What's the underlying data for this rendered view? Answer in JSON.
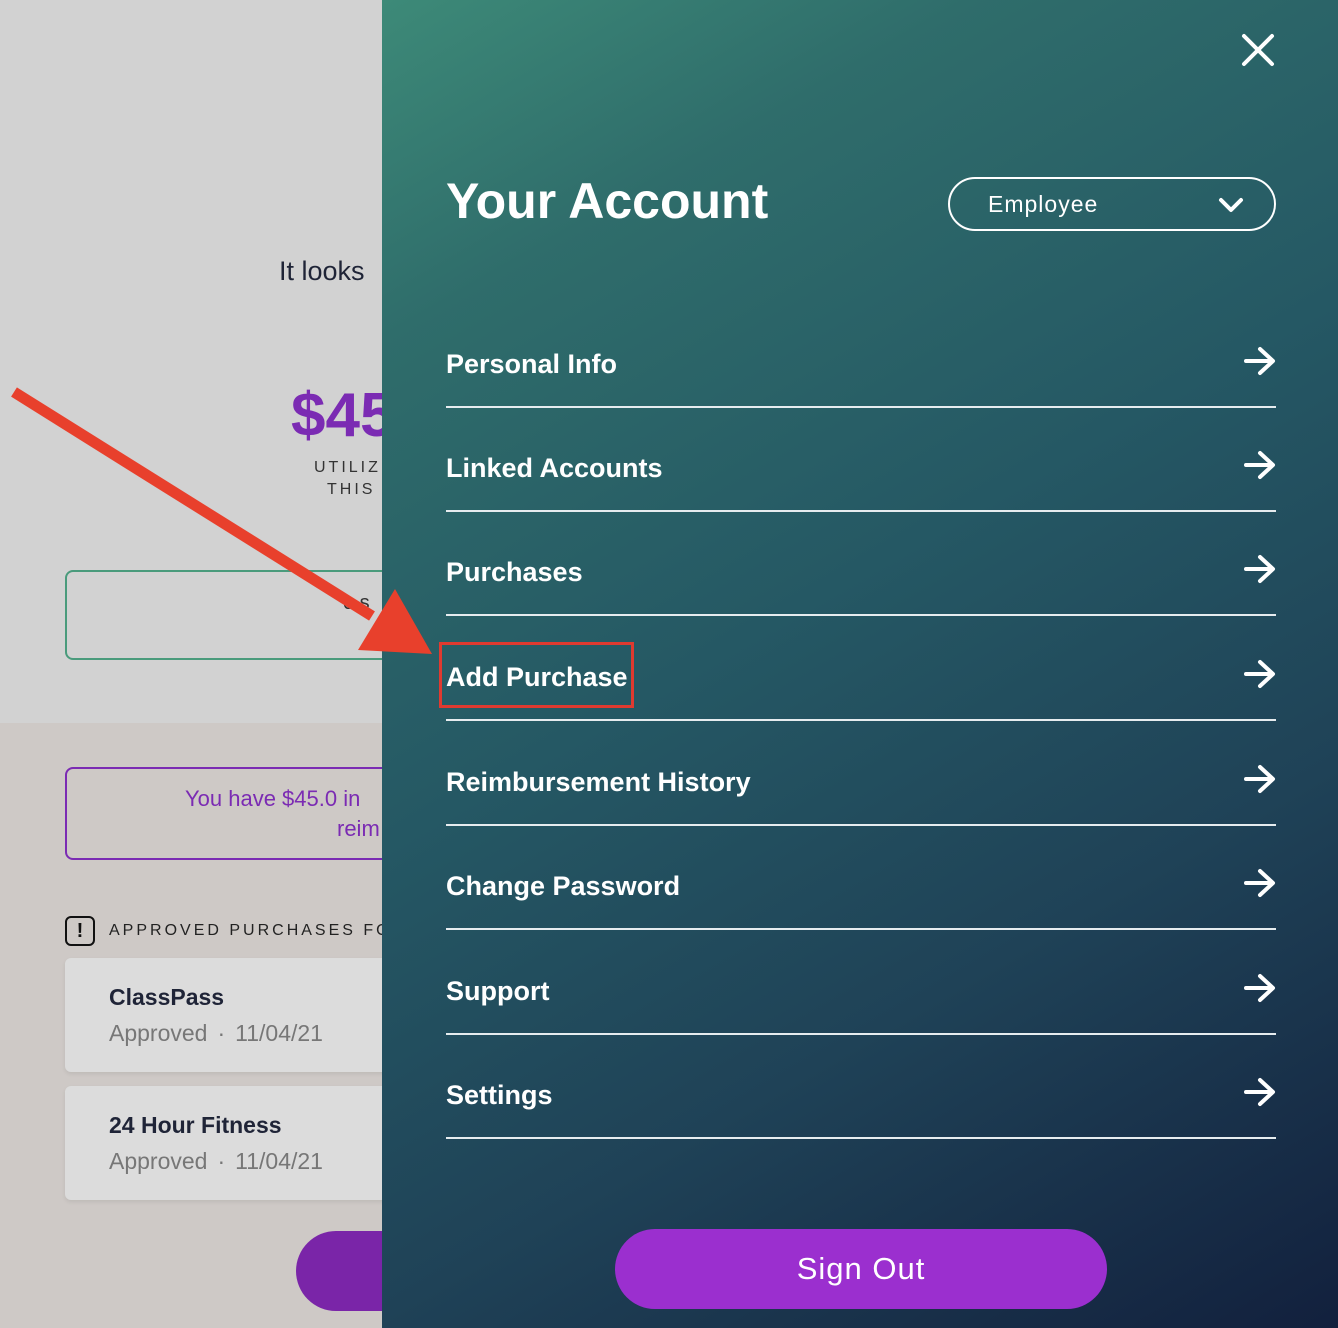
{
  "background": {
    "empty_message": "It looks",
    "amount": "$45",
    "utilized_label": "UTILIZ",
    "this_label": "THIS",
    "outline_button_label": "o s",
    "notice_line1": "You have $45.0 in",
    "notice_line2": "reim",
    "approved_header": "APPROVED PURCHASES FOI",
    "purchases": [
      {
        "name": "ClassPass",
        "status": "Approved",
        "date": "11/04/21"
      },
      {
        "name": "24 Hour Fitness",
        "status": "Approved",
        "date": "11/04/21"
      }
    ]
  },
  "drawer": {
    "title": "Your Account",
    "role_select": {
      "value": "Employee"
    },
    "menu_items": [
      {
        "label": "Personal Info"
      },
      {
        "label": "Linked Accounts"
      },
      {
        "label": "Purchases"
      },
      {
        "label": "Add Purchase",
        "highlighted": true
      },
      {
        "label": "Reimbursement History"
      },
      {
        "label": "Change Password"
      },
      {
        "label": "Support"
      },
      {
        "label": "Settings"
      }
    ],
    "sign_out_label": "Sign Out"
  },
  "colors": {
    "accent_purple": "#9b2fcf",
    "annotation_red": "#e03a30",
    "drawer_teal": "#2f6d6b"
  },
  "icons": {
    "close": "close-icon",
    "dropdown": "chevron-down-icon",
    "menu_arrow": "arrow-right-icon",
    "alert": "alert-icon"
  }
}
